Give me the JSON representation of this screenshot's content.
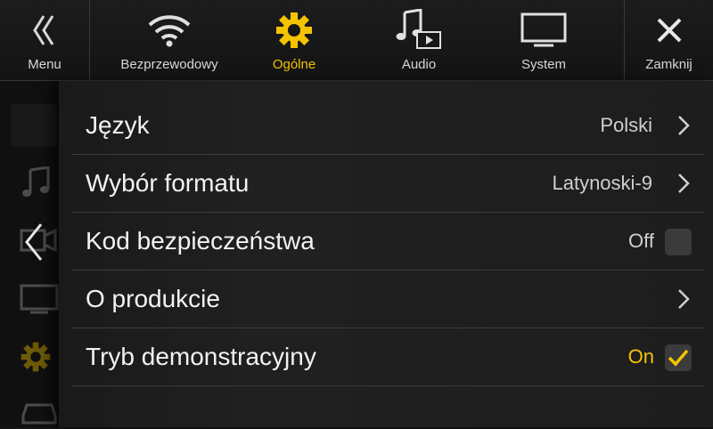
{
  "topbar": {
    "menu_label": "Menu",
    "tabs": [
      {
        "label": "Bezprzewodowy",
        "icon": "wifi-icon"
      },
      {
        "label": "Ogólne",
        "icon": "gear-icon",
        "active": true
      },
      {
        "label": "Audio",
        "icon": "music-note-icon"
      },
      {
        "label": "System",
        "icon": "monitor-icon"
      }
    ],
    "close_label": "Zamknij"
  },
  "settings": {
    "rows": [
      {
        "label": "Język",
        "value": "Polski"
      },
      {
        "label": "Wybór formatu",
        "value": "Latynoski-9"
      },
      {
        "label": "Kod bezpieczeństwa",
        "value": "Off",
        "checked": false
      },
      {
        "label": "O produkcie",
        "value": ""
      },
      {
        "label": "Tryb demonstracyjny",
        "value": "On",
        "checked": true
      }
    ]
  },
  "colors": {
    "accent": "#f5c400",
    "background": "#151515"
  }
}
